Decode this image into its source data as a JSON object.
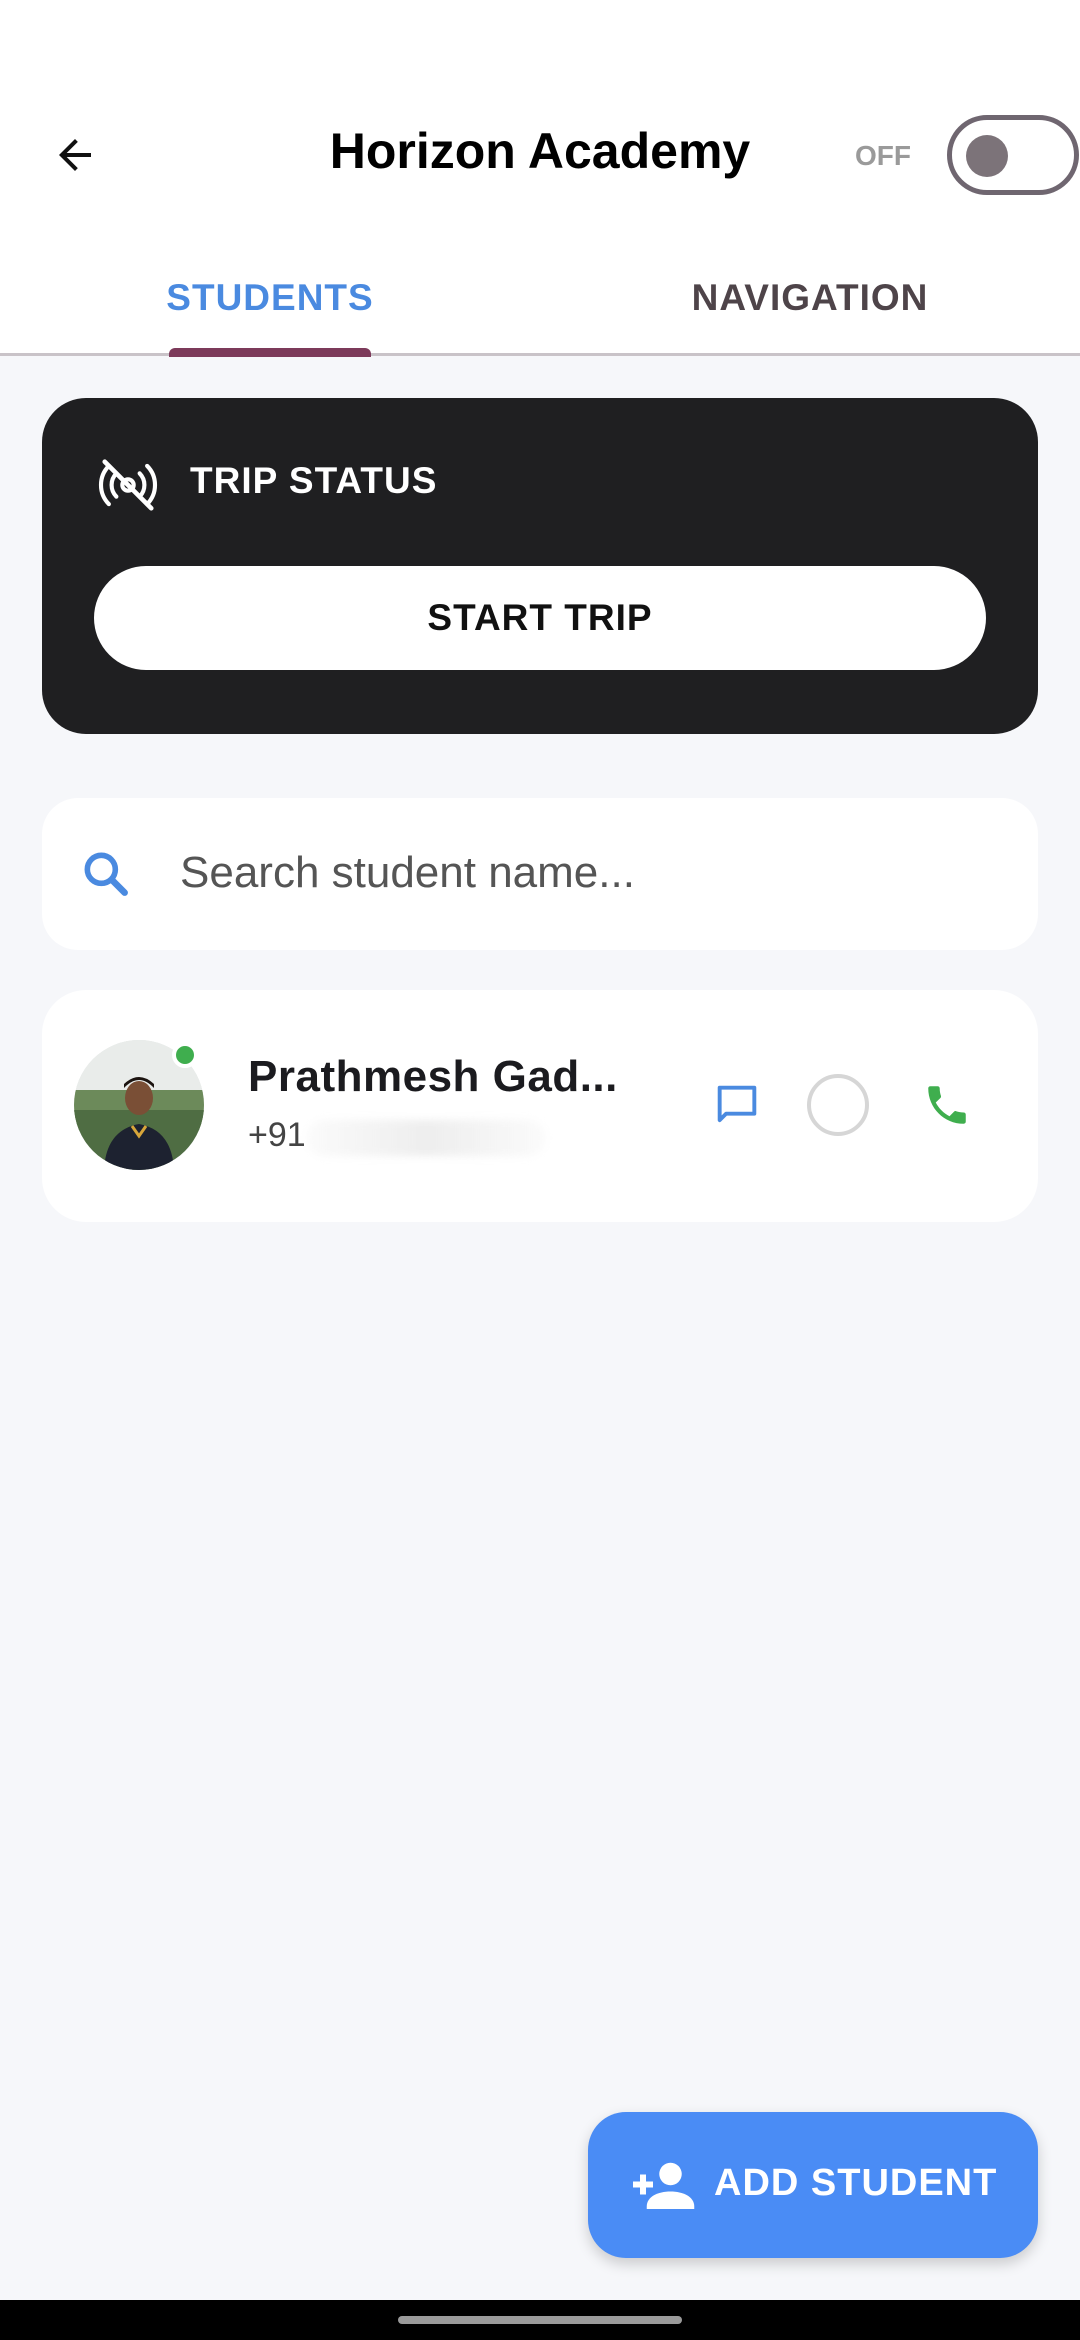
{
  "header": {
    "title": "Horizon Academy",
    "toggle_label": "OFF",
    "back_icon": "arrow-left-icon"
  },
  "tabs": [
    {
      "label": "STUDENTS",
      "active": true
    },
    {
      "label": "NAVIGATION",
      "active": false
    }
  ],
  "trip": {
    "status_label": "TRIP STATUS",
    "status_icon": "location-off-icon",
    "start_button": "START TRIP"
  },
  "search": {
    "placeholder": "Search student name...",
    "value": ""
  },
  "students": [
    {
      "name": "Prathmesh Gad...",
      "phone": "+91",
      "online": true
    }
  ],
  "fab": {
    "label": "ADD STUDENT",
    "icon": "person-add-icon"
  },
  "colors": {
    "accent_blue": "#4a8cf5",
    "tab_indicator": "#7c3a5a",
    "online_green": "#3fae4e",
    "call_green": "#3fae4e",
    "card_dark": "#1f1f21"
  }
}
